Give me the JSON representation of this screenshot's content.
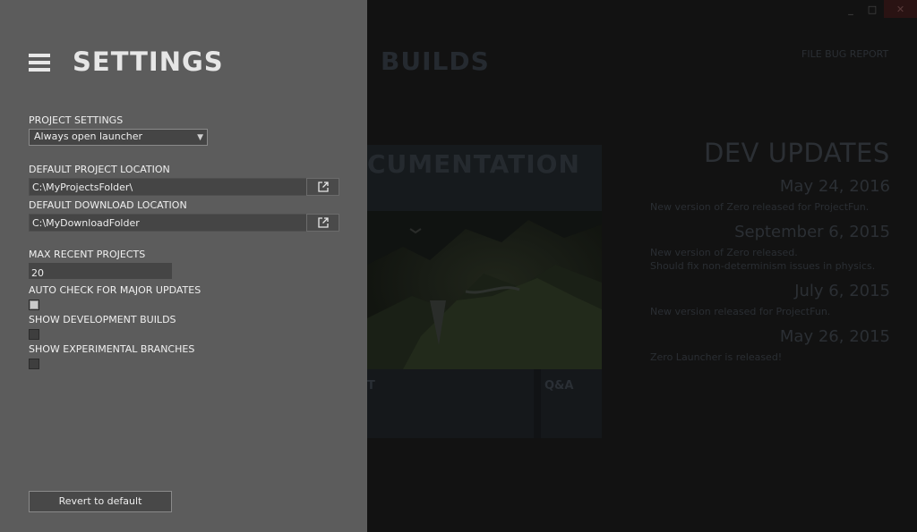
{
  "window": {
    "minimize": "_",
    "maximize": "□",
    "close": "✕"
  },
  "background": {
    "builds_title": "BUILDS",
    "file_bug_report": "FILE BUG REPORT",
    "documentation_banner": "CUMENTATION",
    "tile_a_label": "T",
    "tile_b_label": "Q&A",
    "dev_updates": {
      "title": "DEV UPDATES",
      "entries": [
        {
          "date": "May 24, 2016",
          "text": [
            "New version of Zero released for ProjectFun."
          ]
        },
        {
          "date": "September 6, 2015",
          "text": [
            "New version of Zero released.",
            "Should fix non-determinism issues in physics."
          ]
        },
        {
          "date": "July 6, 2015",
          "text": [
            "New version released for ProjectFun."
          ]
        },
        {
          "date": "May 26, 2015",
          "text": [
            "Zero Launcher is released!"
          ]
        }
      ]
    }
  },
  "settings": {
    "title": "SETTINGS",
    "project_settings": {
      "label": "PROJECT SETTINGS",
      "value": "Always open launcher"
    },
    "default_project_location": {
      "label": "DEFAULT PROJECT LOCATION",
      "value": "C:\\MyProjectsFolder\\"
    },
    "default_download_location": {
      "label": "DEFAULT DOWNLOAD LOCATION",
      "value": "C:\\MyDownloadFolder"
    },
    "max_recent_projects": {
      "label": "MAX RECENT PROJECTS",
      "value": "20"
    },
    "auto_check_updates": {
      "label": "AUTO CHECK FOR MAJOR UPDATES",
      "checked": true
    },
    "show_dev_builds": {
      "label": "SHOW DEVELOPMENT BUILDS",
      "checked": false
    },
    "show_experimental": {
      "label": "SHOW EXPERIMENTAL BRANCHES",
      "checked": false
    },
    "revert_button": "Revert to default"
  },
  "icons": {
    "menu": "hamburger-menu-icon",
    "browse": "open-external-icon",
    "dropdown": "chevron-down-icon"
  }
}
